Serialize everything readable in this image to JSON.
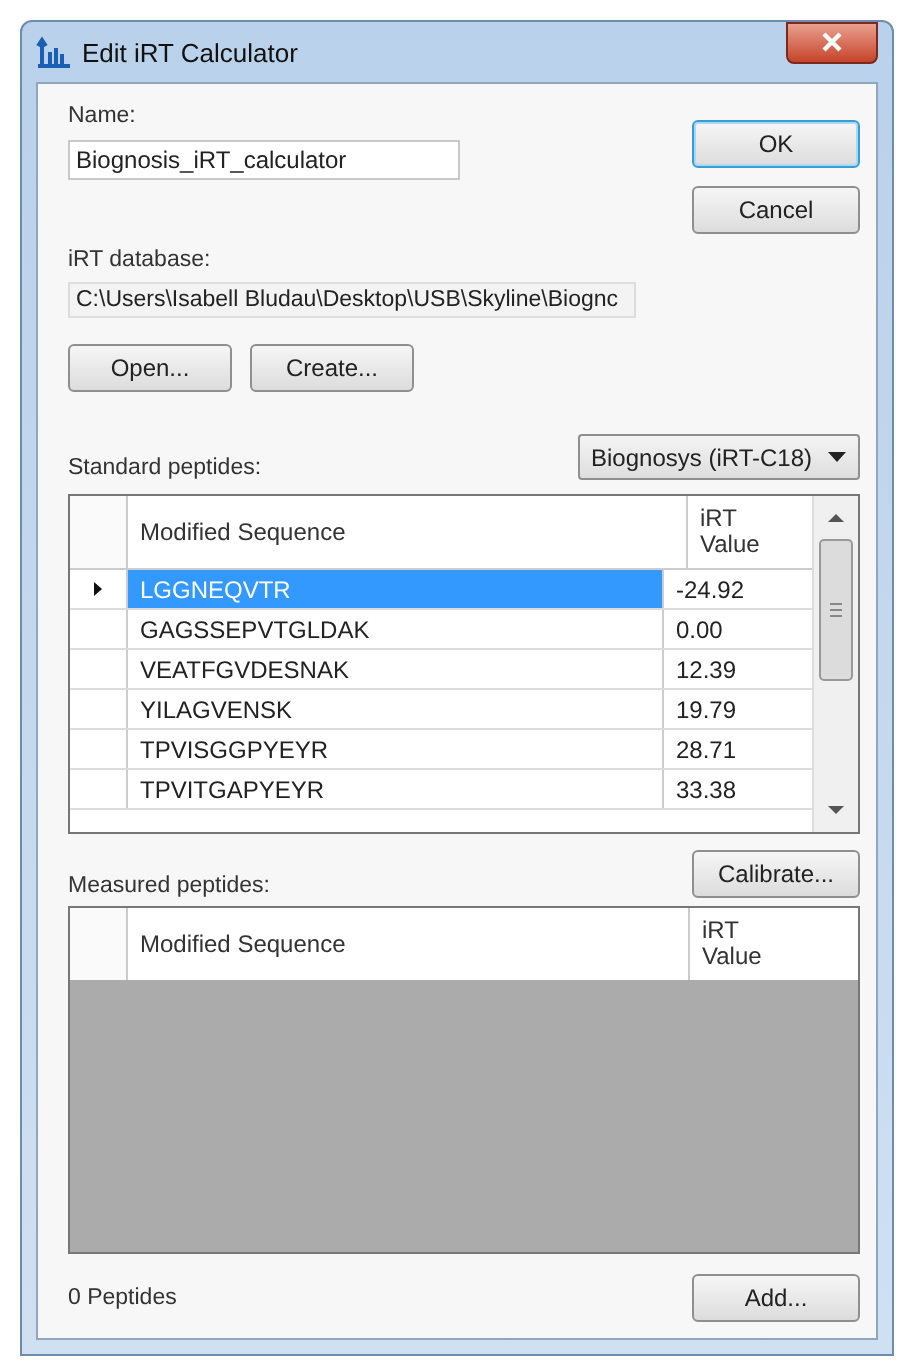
{
  "window": {
    "title": "Edit iRT Calculator"
  },
  "name": {
    "label": "Name:",
    "value": "Biognosis_iRT_calculator"
  },
  "buttons": {
    "ok": "OK",
    "cancel": "Cancel",
    "open": "Open...",
    "create": "Create...",
    "calibrate": "Calibrate...",
    "add": "Add..."
  },
  "database": {
    "label": "iRT database:",
    "path": "C:\\Users\\Isabell Bludau\\Desktop\\USB\\Skyline\\Biognc"
  },
  "standard": {
    "label": "Standard peptides:",
    "dropdown": "Biognosys (iRT-C18)",
    "columns": [
      "Modified Sequence",
      "iRT Value"
    ],
    "rows": [
      {
        "sequence": "LGGNEQVTR",
        "value": "-24.92",
        "selected": true
      },
      {
        "sequence": "GAGSSEPVTGLDAK",
        "value": "0.00",
        "selected": false
      },
      {
        "sequence": "VEATFGVDESNAK",
        "value": "12.39",
        "selected": false
      },
      {
        "sequence": "YILAGVENSK",
        "value": "19.79",
        "selected": false
      },
      {
        "sequence": "TPVISGGPYEYR",
        "value": "28.71",
        "selected": false
      },
      {
        "sequence": "TPVITGAPYEYR",
        "value": "33.38",
        "selected": false
      }
    ]
  },
  "measured": {
    "label": "Measured peptides:",
    "columns": [
      "Modified Sequence",
      "iRT Value"
    ]
  },
  "status": "0 Peptides"
}
